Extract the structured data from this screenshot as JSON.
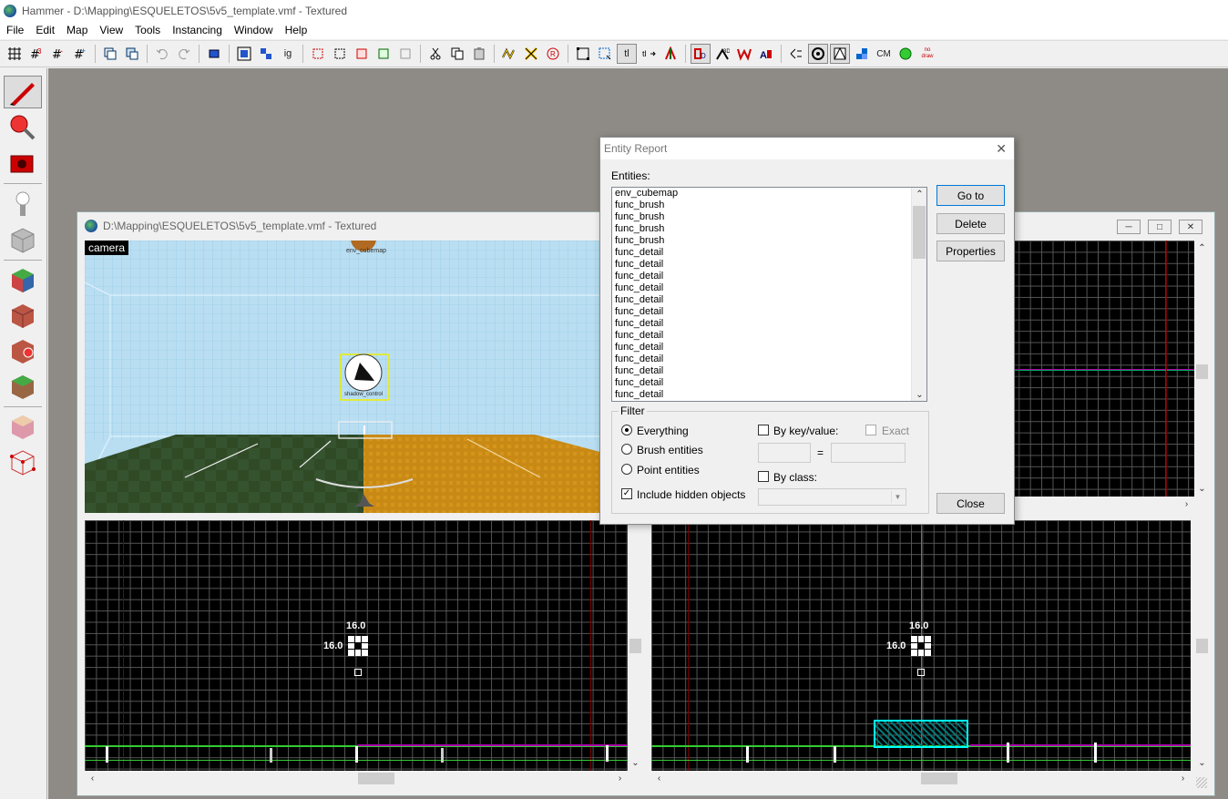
{
  "window": {
    "title": "Hammer - D:\\Mapping\\ESQUELETOS\\5v5_template.vmf - Textured"
  },
  "menu": [
    "File",
    "Edit",
    "Map",
    "View",
    "Tools",
    "Instancing",
    "Window",
    "Help"
  ],
  "toolbar": {
    "ig_label": "ig",
    "tl_label": "tl",
    "cm_label": "CM",
    "nodraw_label": "no draw"
  },
  "document": {
    "title": "D:\\Mapping\\ESQUELETOS\\5v5_template.vmf - Textured",
    "camera_label": "camera",
    "entity_labels": {
      "cubemap": "env_cubemap",
      "shadow": "shadow_control"
    }
  },
  "viewports": {
    "bottom_left": {
      "size_x": "16.0",
      "size_y": "16.0"
    },
    "bottom_right": {
      "size_x": "16.0",
      "size_y": "16.0"
    }
  },
  "dialog": {
    "title": "Entity Report",
    "entities_label": "Entities:",
    "entities": [
      "env_cubemap",
      "func_brush",
      "func_brush",
      "func_brush",
      "func_brush",
      "func_detail",
      "func_detail",
      "func_detail",
      "func_detail",
      "func_detail",
      "func_detail",
      "func_detail",
      "func_detail",
      "func_detail",
      "func_detail",
      "func_detail",
      "func_detail",
      "func_detail"
    ],
    "buttons": {
      "goto": "Go to",
      "delete": "Delete",
      "properties": "Properties",
      "close": "Close"
    },
    "filter": {
      "legend": "Filter",
      "everything": "Everything",
      "brush_entities": "Brush entities",
      "point_entities": "Point entities",
      "include_hidden": "Include hidden objects",
      "by_keyvalue": "By key/value:",
      "exact": "Exact",
      "equals": "=",
      "by_class": "By class:",
      "selected_radio": "everything",
      "include_hidden_checked": true,
      "by_keyvalue_checked": false,
      "by_class_checked": false
    }
  }
}
